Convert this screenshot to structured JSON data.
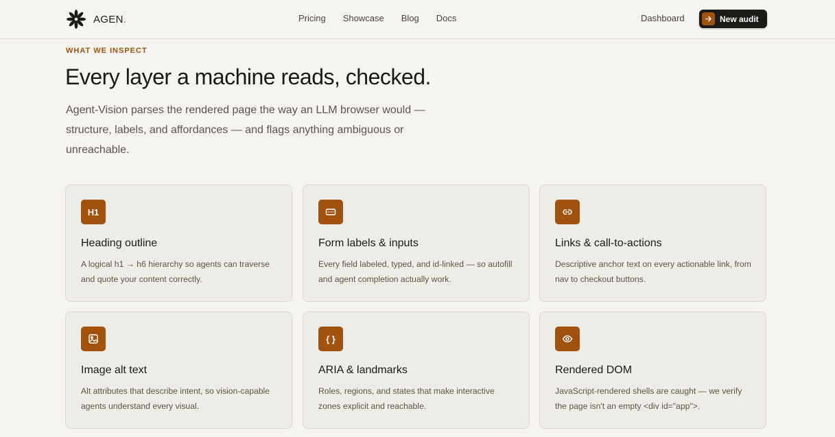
{
  "header": {
    "brand": "AGEN",
    "brand_dot": ".",
    "nav": [
      "Pricing",
      "Showcase",
      "Blog",
      "Docs"
    ],
    "dashboard_label": "Dashboard",
    "cta_label": "New audit",
    "accent_color": "#a0520e"
  },
  "hero": {
    "eyebrow": "WHAT WE INSPECT",
    "title": "Every layer a machine reads, checked.",
    "lede": "Agent-Vision parses the rendered page the way an LLM browser would — structure, labels, and affordances — and flags anything ambiguous or unreachable."
  },
  "cards": [
    {
      "icon": "heading-icon",
      "icon_text": "H1",
      "title": "Heading outline",
      "desc": "A logical h1 → h6 hierarchy so agents can traverse and quote your content correctly."
    },
    {
      "icon": "keyboard-icon",
      "title": "Form labels & inputs",
      "desc": "Every field labeled, typed, and id-linked — so autofill and agent completion actually work."
    },
    {
      "icon": "link-icon",
      "title": "Links & call-to-actions",
      "desc": "Descriptive anchor text on every actionable link, from nav to checkout buttons."
    },
    {
      "icon": "image-icon",
      "title": "Image alt text",
      "desc": "Alt attributes that describe intent, so vision-capable agents understand every visual."
    },
    {
      "icon": "braces-icon",
      "icon_text": "{ }",
      "title": "ARIA & landmarks",
      "desc": "Roles, regions, and states that make interactive zones explicit and reachable."
    },
    {
      "icon": "eye-icon",
      "title": "Rendered DOM",
      "desc": "JavaScript-rendered shells are caught — we verify the page isn't an empty <div id=\"app\">."
    }
  ]
}
